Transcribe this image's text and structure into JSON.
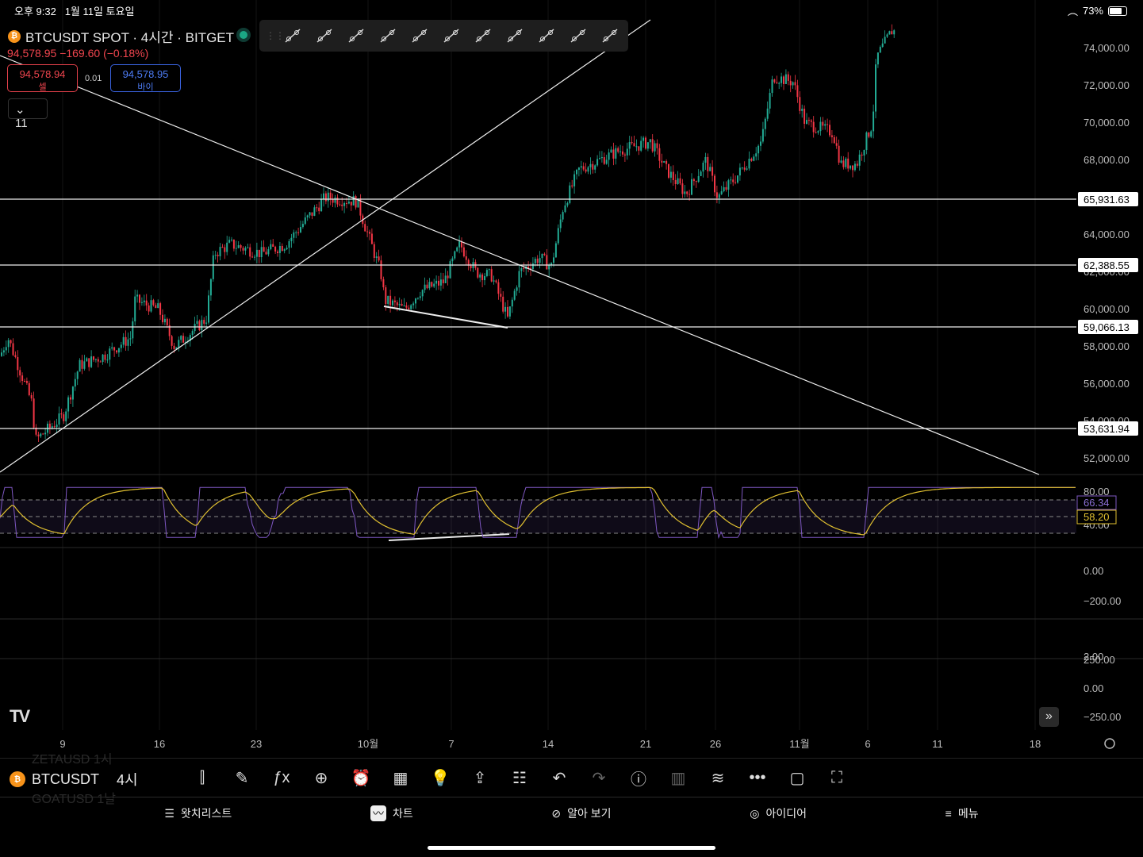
{
  "status": {
    "time": "오후 9:32",
    "date": "1월 11일 토요일",
    "battery": "73%"
  },
  "header": {
    "symbol_title": "BTCUSDT SPOT · 4시간 · BITGET",
    "coin_glyph": "₿",
    "price": "94,578.95",
    "change": "−169.60 (−0.18%)",
    "sell_price": "94,578.94",
    "sell_label": "셀",
    "buy_price": "94,578.95",
    "buy_label": "바이",
    "spread": "0.01",
    "collapse_count": "11"
  },
  "colors": {
    "up": "#22ab94",
    "down": "#f23645",
    "rsi": "#7e57c2",
    "rsi_ma": "#e0c030",
    "bg": "#000000"
  },
  "drawing_tools": [
    "trend-line",
    "horizontal-ray",
    "extended-line",
    "ray",
    "parallel-channel",
    "fib-retracement",
    "brush",
    "rectangle",
    "crosshair-measure",
    "pitchfork",
    "gann-fan"
  ],
  "price_axis": [
    "74,000.00",
    "72,000.00",
    "70,000.00",
    "68,000.00",
    "64,000.00",
    "62,000.00",
    "60,000.00",
    "58,000.00",
    "56,000.00",
    "54,000.00",
    "52,000.00"
  ],
  "horizontal_levels": [
    "65,931.63",
    "62,388.55",
    "59,066.13",
    "53,631.94"
  ],
  "rsi_axis": {
    "top": "80.00",
    "bottom": "40.00",
    "rsi_value": "66.34",
    "ma_value": "58.20"
  },
  "pane2_axis": [
    "0.00",
    "−200.00"
  ],
  "pane3_axis": [
    "250.00",
    "2.00",
    "0.00",
    "−250.00"
  ],
  "time_axis": [
    "9",
    "16",
    "23",
    "10월",
    "7",
    "14",
    "21",
    "26",
    "11월",
    "6",
    "11",
    "18"
  ],
  "bottom_toolbar": {
    "symbol": "BTCUSDT",
    "interval": "4시",
    "ghost_above": "ZETAUSD  1시",
    "ghost_below": "GOATUSD  1날"
  },
  "nav": [
    "왓치리스트",
    "차트",
    "알아 보기",
    "아이디어",
    "메뉴"
  ],
  "chart_data": {
    "type": "candlestick",
    "title": "BTCUSDT SPOT · 4시간 · BITGET",
    "ylim": [
      51000,
      75500
    ],
    "close_path": [
      [
        0,
        57500
      ],
      [
        10,
        58500
      ],
      [
        40,
        55000
      ],
      [
        45,
        53000
      ],
      [
        80,
        54300
      ],
      [
        100,
        57000
      ],
      [
        130,
        57500
      ],
      [
        165,
        58500
      ],
      [
        170,
        60500
      ],
      [
        200,
        60000
      ],
      [
        220,
        58000
      ],
      [
        260,
        59500
      ],
      [
        270,
        63000
      ],
      [
        290,
        63500
      ],
      [
        330,
        63000
      ],
      [
        360,
        63500
      ],
      [
        390,
        65000
      ],
      [
        410,
        66000
      ],
      [
        450,
        65800
      ],
      [
        460,
        64500
      ],
      [
        480,
        62000
      ],
      [
        485,
        60500
      ],
      [
        510,
        60000
      ],
      [
        530,
        61000
      ],
      [
        560,
        61500
      ],
      [
        580,
        63500
      ],
      [
        600,
        62000
      ],
      [
        620,
        61800
      ],
      [
        640,
        59500
      ],
      [
        655,
        62000
      ],
      [
        680,
        62800
      ],
      [
        695,
        62300
      ],
      [
        710,
        65500
      ],
      [
        730,
        67500
      ],
      [
        780,
        68500
      ],
      [
        820,
        69000
      ],
      [
        840,
        67500
      ],
      [
        865,
        66200
      ],
      [
        890,
        68000
      ],
      [
        905,
        66000
      ],
      [
        930,
        67200
      ],
      [
        960,
        69000
      ],
      [
        975,
        72500
      ],
      [
        1000,
        72200
      ],
      [
        1015,
        70000
      ],
      [
        1050,
        69500
      ],
      [
        1060,
        67800
      ],
      [
        1080,
        67800
      ],
      [
        1100,
        70000
      ],
      [
        1105,
        73500
      ],
      [
        1125,
        75000
      ],
      [
        1130,
        74800
      ]
    ]
  }
}
